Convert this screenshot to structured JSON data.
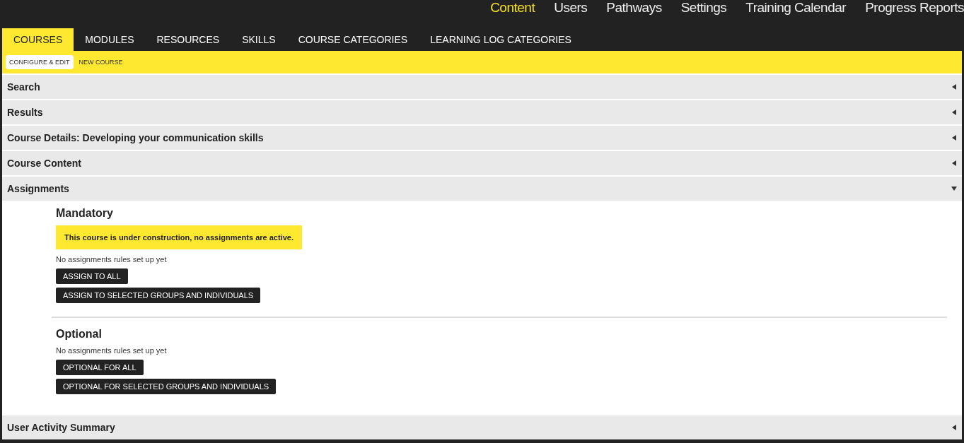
{
  "top_nav": [
    {
      "label": "Content",
      "selected": true
    },
    {
      "label": "Users",
      "selected": false
    },
    {
      "label": "Pathways",
      "selected": false
    },
    {
      "label": "Settings",
      "selected": false
    },
    {
      "label": "Training Calendar",
      "selected": false
    },
    {
      "label": "Progress Reports",
      "selected": false
    }
  ],
  "tabs": [
    {
      "label": "COURSES",
      "selected": true
    },
    {
      "label": "MODULES",
      "selected": false
    },
    {
      "label": "RESOURCES",
      "selected": false
    },
    {
      "label": "SKILLS",
      "selected": false
    },
    {
      "label": "COURSE CATEGORIES",
      "selected": false
    },
    {
      "label": "LEARNING LOG CATEGORIES",
      "selected": false
    }
  ],
  "subtabs": [
    {
      "label": "CONFIGURE & EDIT",
      "selected": true
    },
    {
      "label": "NEW COURSE",
      "selected": false
    }
  ],
  "sections": [
    {
      "title": "Search",
      "expanded": false
    },
    {
      "title": "Results",
      "expanded": false
    },
    {
      "title": "Course Details: Developing your communication skills",
      "expanded": false
    },
    {
      "title": "Course Content",
      "expanded": false
    },
    {
      "title": "Assignments",
      "expanded": true,
      "groups": [
        {
          "heading": "Mandatory",
          "notice": "This course is under construction, no assignments are active.",
          "status": "No assignments rules set up yet",
          "buttons": [
            "ASSIGN TO ALL",
            "ASSIGN TO SELECTED GROUPS AND INDIVIDUALS"
          ]
        },
        {
          "heading": "Optional",
          "status": "No assignments rules set up yet",
          "buttons": [
            "OPTIONAL FOR ALL",
            "OPTIONAL FOR SELECTED GROUPS AND INDIVIDUALS"
          ]
        }
      ]
    },
    {
      "title": "User Activity Summary",
      "expanded": false
    }
  ]
}
